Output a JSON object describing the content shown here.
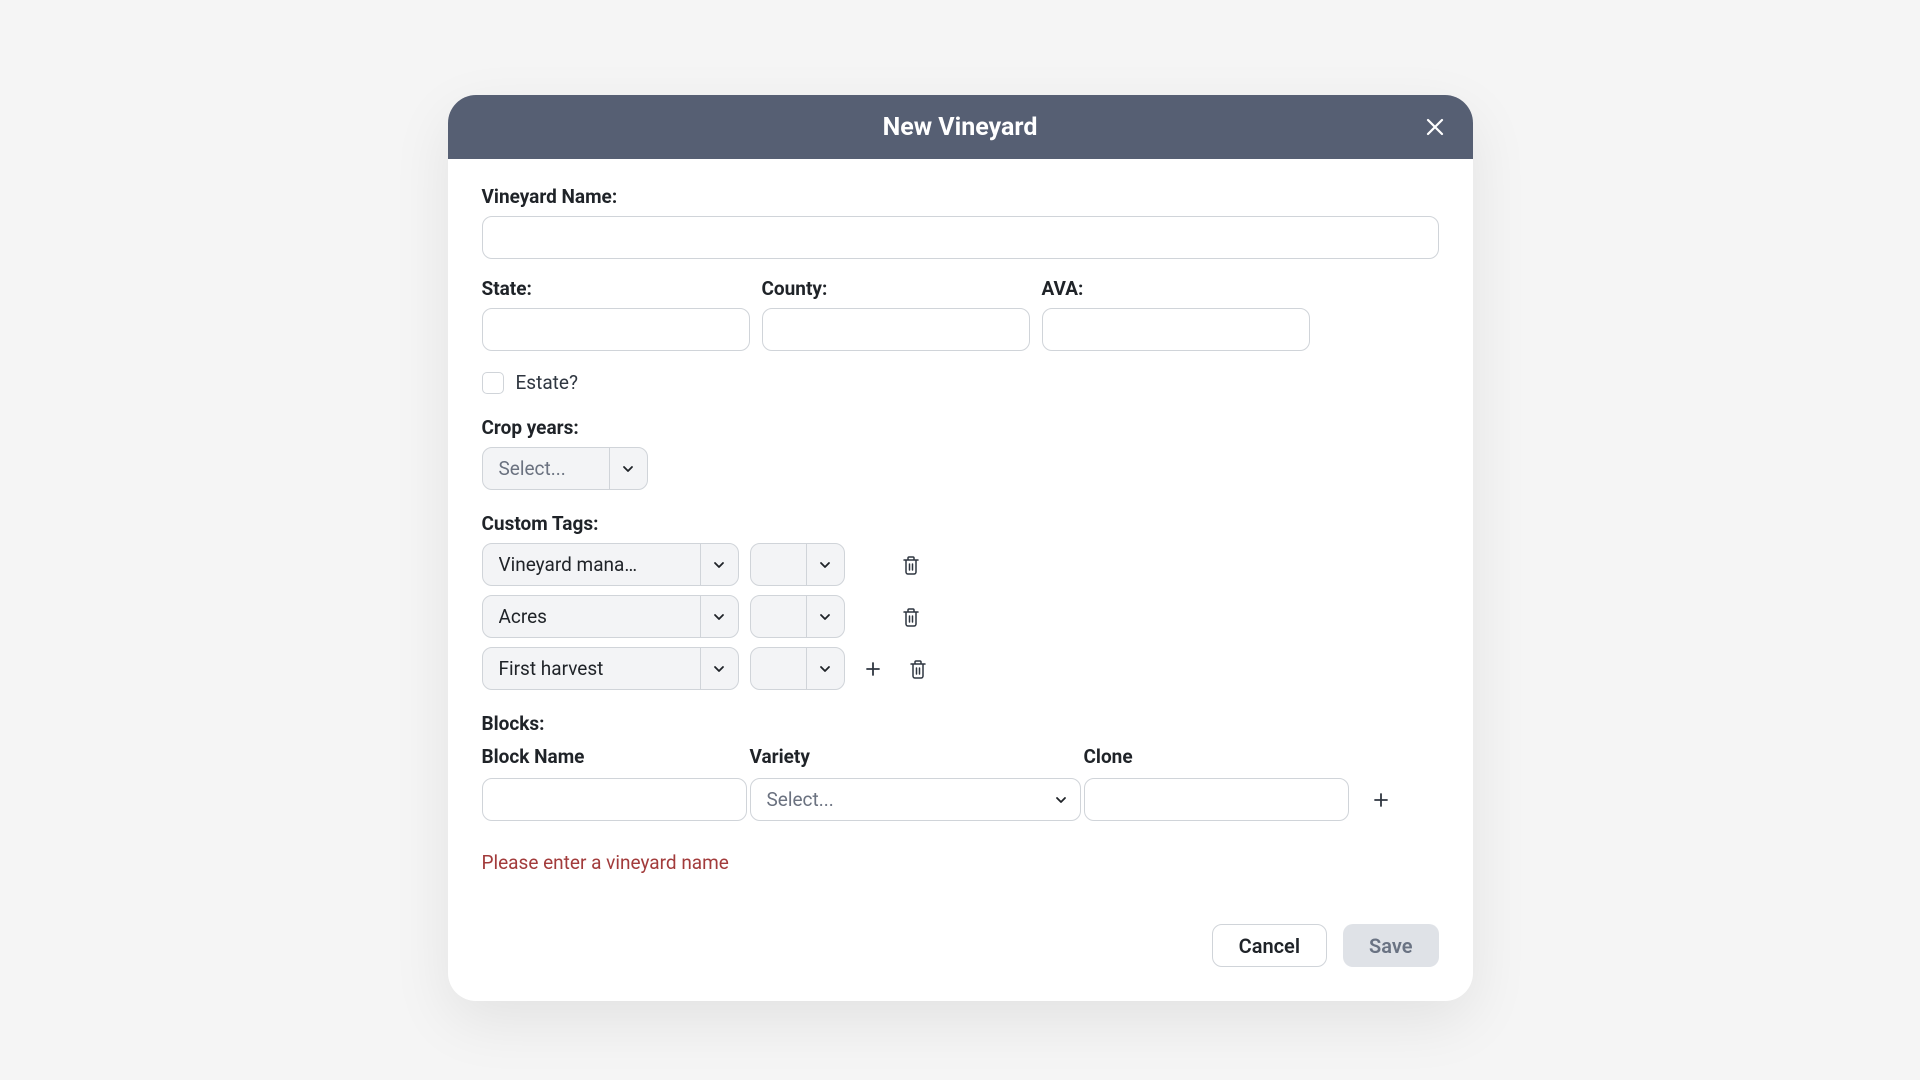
{
  "modal": {
    "title": "New Vineyard",
    "labels": {
      "vineyard_name": "Vineyard Name:",
      "state": "State:",
      "county": "County:",
      "ava": "AVA:",
      "estate": "Estate?",
      "crop_years": "Crop years:",
      "custom_tags": "Custom Tags:",
      "blocks": "Blocks:",
      "block_name": "Block Name",
      "variety": "Variety",
      "clone": "Clone"
    },
    "fields": {
      "vineyard_name": "",
      "state": "",
      "county": "",
      "ava": "",
      "estate_checked": false,
      "crop_years_placeholder": "Select..."
    },
    "custom_tags_rows": [
      {
        "name": "Vineyard mana…",
        "value": "",
        "show_add": false
      },
      {
        "name": "Acres",
        "value": "",
        "show_add": false
      },
      {
        "name": "First harvest",
        "value": "",
        "show_add": true
      }
    ],
    "blocks_rows": [
      {
        "block_name": "",
        "variety_placeholder": "Select...",
        "clone": ""
      }
    ],
    "error": "Please enter a vineyard name",
    "buttons": {
      "cancel": "Cancel",
      "save": "Save"
    }
  }
}
